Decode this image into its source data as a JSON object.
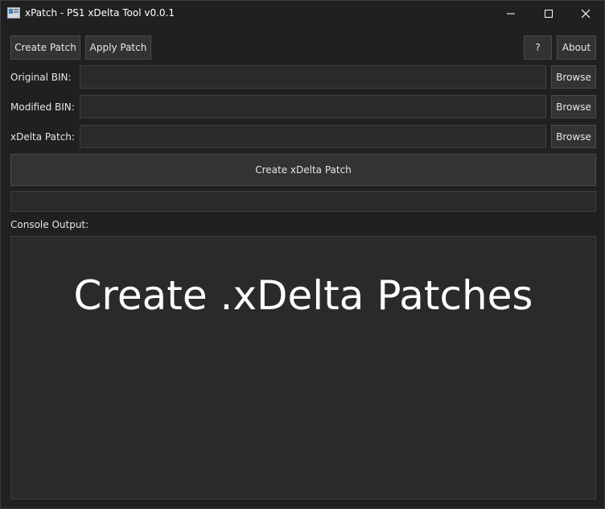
{
  "window": {
    "title": "xPatch - PS1 xDelta Tool v0.0.1",
    "icon": "app-icon",
    "controls": [
      "minimize-icon",
      "maximize-icon",
      "close-icon"
    ]
  },
  "toolbar": {
    "create_patch_label": "Create Patch",
    "apply_patch_label": "Apply Patch",
    "help_label": "?",
    "about_label": "About"
  },
  "fields": {
    "original_bin": {
      "label": "Original BIN:",
      "value": "",
      "browse_label": "Browse"
    },
    "modified_bin": {
      "label": "Modified BIN:",
      "value": "",
      "browse_label": "Browse"
    },
    "xdelta_patch": {
      "label": "xDelta Patch:",
      "value": "",
      "browse_label": "Browse"
    }
  },
  "action": {
    "label": "Create xDelta Patch"
  },
  "progress": {
    "value": 0
  },
  "console": {
    "label": "Console Output:",
    "text": "Create .xDelta Patches"
  },
  "colors": {
    "background": "#202020",
    "panel": "#2a2a2a",
    "button": "#333333",
    "text": "#e6e6e6"
  }
}
